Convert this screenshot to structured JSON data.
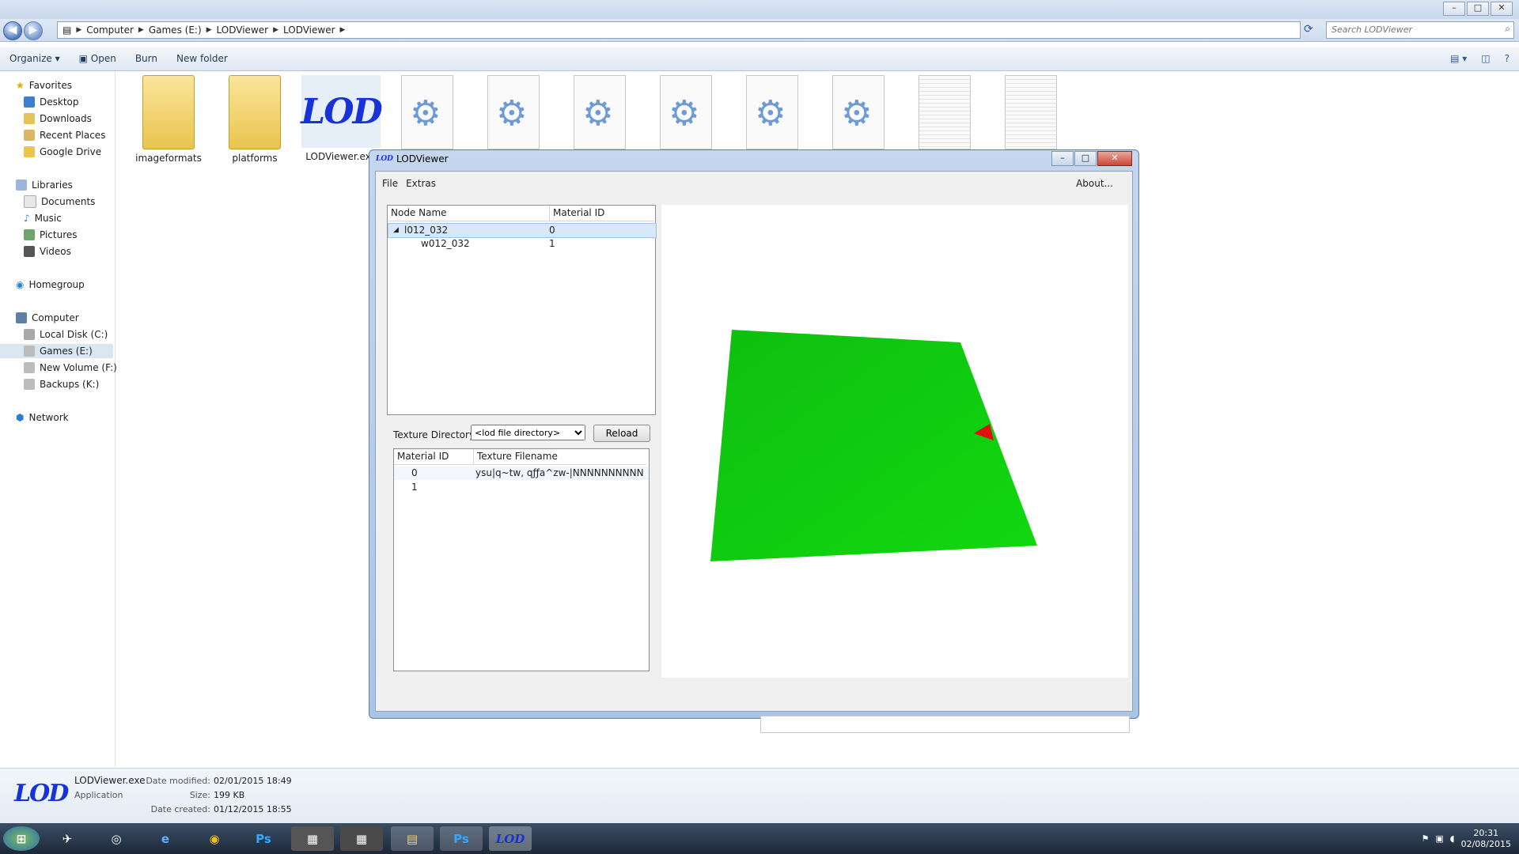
{
  "breadcrumb": [
    "Computer",
    "Games (E:)",
    "LODViewer",
    "LODViewer"
  ],
  "search": {
    "placeholder": "Search LODViewer"
  },
  "toolbar": {
    "organize": "Organize",
    "open": "Open",
    "burn": "Burn",
    "new_folder": "New folder"
  },
  "sidebar": {
    "favorites": "Favorites",
    "favorites_items": [
      "Desktop",
      "Downloads",
      "Recent Places",
      "Google Drive"
    ],
    "libraries": "Libraries",
    "libraries_items": [
      "Documents",
      "Music",
      "Pictures",
      "Videos"
    ],
    "homegroup": "Homegroup",
    "computer": "Computer",
    "computer_items": [
      "Local Disk (C:)",
      "Games (E:)",
      "New Volume (F:)",
      "Backups (K:)"
    ],
    "network": "Network"
  },
  "files": [
    "imageformats",
    "platforms",
    "LODViewer.exe"
  ],
  "details": {
    "name": "LODViewer.exe",
    "type": "Application",
    "modified_label": "Date modified:",
    "modified": "02/01/2015 18:49",
    "size_label": "Size:",
    "size": "199 KB",
    "created_label": "Date created:",
    "created": "01/12/2015 18:55"
  },
  "clock": {
    "time": "20:31",
    "date": "02/08/2015"
  },
  "lodviewer": {
    "title": "LODViewer",
    "menu": [
      "File",
      "Extras"
    ],
    "about": "About...",
    "tree": {
      "headers": [
        "Node Name",
        "Material ID"
      ],
      "rows": [
        {
          "name": "l012_032",
          "material": "0"
        },
        {
          "name": "w012_032",
          "material": "1"
        }
      ]
    },
    "texture_directory_label": "Texture Directory:",
    "texture_directory_value": "<lod file directory>",
    "reload": "Reload",
    "texture_table": {
      "headers": [
        "Material ID",
        "Texture Filename"
      ],
      "rows": [
        {
          "id": "0",
          "file": "ysu|q~tw, qƒƒa^zw-|NNNNNNNNNN..."
        },
        {
          "id": "1",
          "file": ""
        }
      ]
    }
  },
  "colors": {
    "accent": "#3a6ea5",
    "mesh_green": "#11d811",
    "marker_red": "#e01010",
    "lod_logo": "#1733d8"
  }
}
